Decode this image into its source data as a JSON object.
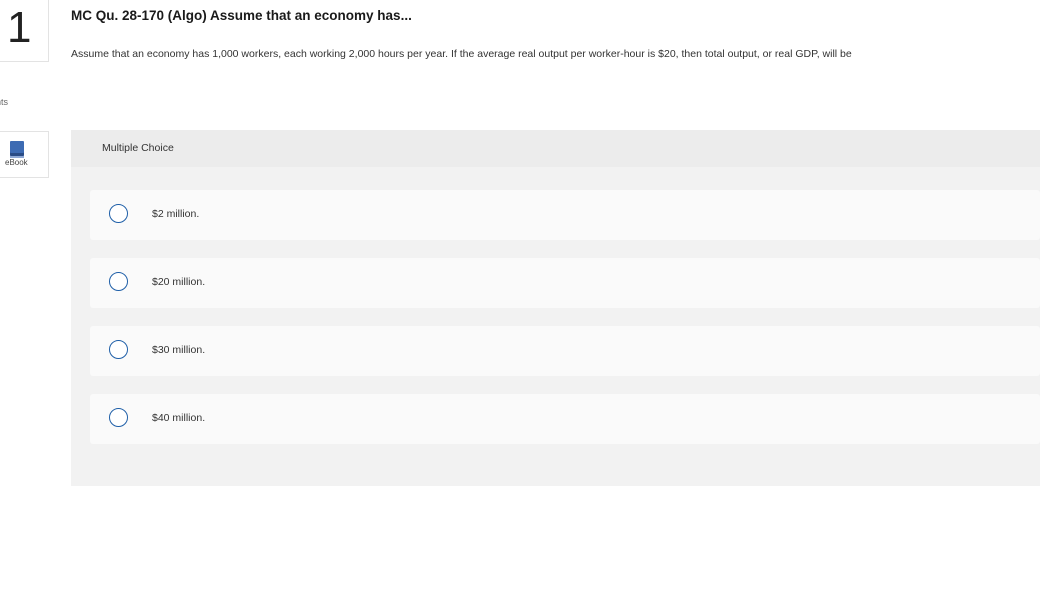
{
  "question": {
    "number": "1",
    "points_label": "ints",
    "title": "MC Qu. 28-170 (Algo) Assume that an economy has...",
    "text": "Assume that an economy has 1,000 workers, each working 2,000 hours per year. If the average real output per worker-hour is $20, then total output, or real GDP, will be"
  },
  "ebook": {
    "label": "eBook",
    "icon": "book-icon"
  },
  "multiple_choice": {
    "header": "Multiple Choice",
    "options": [
      {
        "label": "$2 million.",
        "selected": false
      },
      {
        "label": "$20 million.",
        "selected": false
      },
      {
        "label": "$30 million.",
        "selected": false
      },
      {
        "label": "$40 million.",
        "selected": false
      }
    ]
  },
  "colors": {
    "radio_border": "#1f5fa8",
    "panel_bg": "#f2f2f2",
    "option_bg": "#fafafa"
  }
}
